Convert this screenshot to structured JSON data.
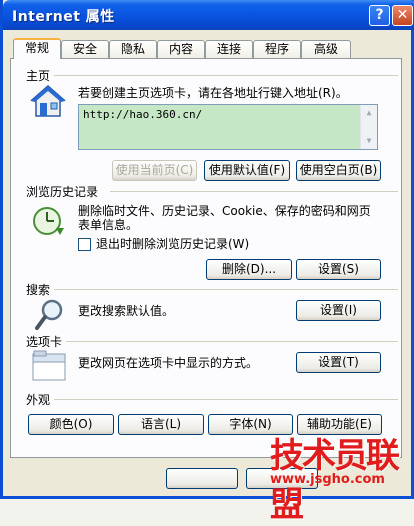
{
  "window": {
    "title": "Internet 属性",
    "help": "?",
    "close": "✕"
  },
  "tabs": [
    "常规",
    "安全",
    "隐私",
    "内容",
    "连接",
    "程序",
    "高级"
  ],
  "homepage": {
    "label": "主页",
    "description": "若要创建主页选项卡，请在各地址行键入地址(R)。",
    "url": "http://hao.360.cn/",
    "btn_current": "使用当前页(C)",
    "btn_default": "使用默认值(F)",
    "btn_blank": "使用空白页(B)"
  },
  "history": {
    "label": "浏览历史记录",
    "description_line1": "删除临时文件、历史记录、Cookie、保存的密码和网页",
    "description_line2": "表单信息。",
    "checkbox_label": "退出时删除浏览历史记录(W)",
    "btn_delete": "删除(D)...",
    "btn_settings": "设置(S)"
  },
  "search": {
    "label": "搜索",
    "description": "更改搜索默认值。",
    "btn_settings": "设置(I)"
  },
  "tabs_section": {
    "label": "选项卡",
    "description": "更改网页在选项卡中显示的方式。",
    "btn_settings": "设置(T)"
  },
  "appearance": {
    "label": "外观",
    "btn_colors": "颜色(O)",
    "btn_languages": "语言(L)",
    "btn_fonts": "字体(N)",
    "btn_accessibility": "辅助功能(E)"
  },
  "watermark": {
    "main": "技术员联盟",
    "sub": "www.jsgho.com"
  }
}
